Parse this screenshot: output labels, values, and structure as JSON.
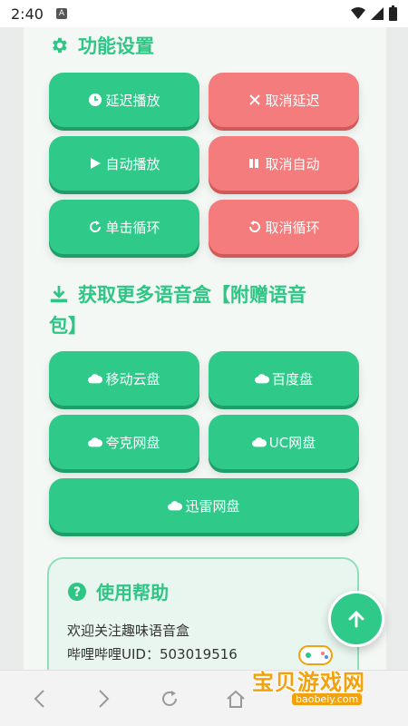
{
  "status_bar": {
    "time": "2:40",
    "notif": "A"
  },
  "features": {
    "title": "功能设置",
    "buttons": [
      {
        "label": "延迟播放",
        "icon": "clock-icon",
        "color": "#2fc98a"
      },
      {
        "label": "取消延迟",
        "icon": "x-icon",
        "color": "#f47c7c"
      },
      {
        "label": "自动播放",
        "icon": "play-icon",
        "color": "#2fc98a"
      },
      {
        "label": "取消自动",
        "icon": "pause-icon",
        "color": "#f47c7c"
      },
      {
        "label": "单击循环",
        "icon": "redo-icon",
        "color": "#2fc98a"
      },
      {
        "label": "取消循环",
        "icon": "undo-icon",
        "color": "#f47c7c"
      }
    ]
  },
  "downloads": {
    "title_line1": "获取更多语音盒【附赠语音",
    "title_line2": "包】",
    "buttons": [
      {
        "label": "移动云盘",
        "icon": "cloud-icon"
      },
      {
        "label": "百度盘",
        "icon": "cloud-icon"
      },
      {
        "label": "夸克网盘",
        "icon": "cloud-icon"
      },
      {
        "label": "UC网盘",
        "icon": "cloud-icon"
      },
      {
        "label": "迅雷网盘",
        "icon": "cloud-icon"
      }
    ]
  },
  "help": {
    "title": "使用帮助",
    "line1": "欢迎关注趣味语音盒",
    "line2": "哔哩哔哩UID：503019516"
  },
  "watermark": {
    "text": "宝贝游戏网",
    "url": "baobeiy.com"
  },
  "colors": {
    "accent": "#2ec685",
    "green_button": "#2fc98a",
    "red_button": "#f47c7c"
  }
}
